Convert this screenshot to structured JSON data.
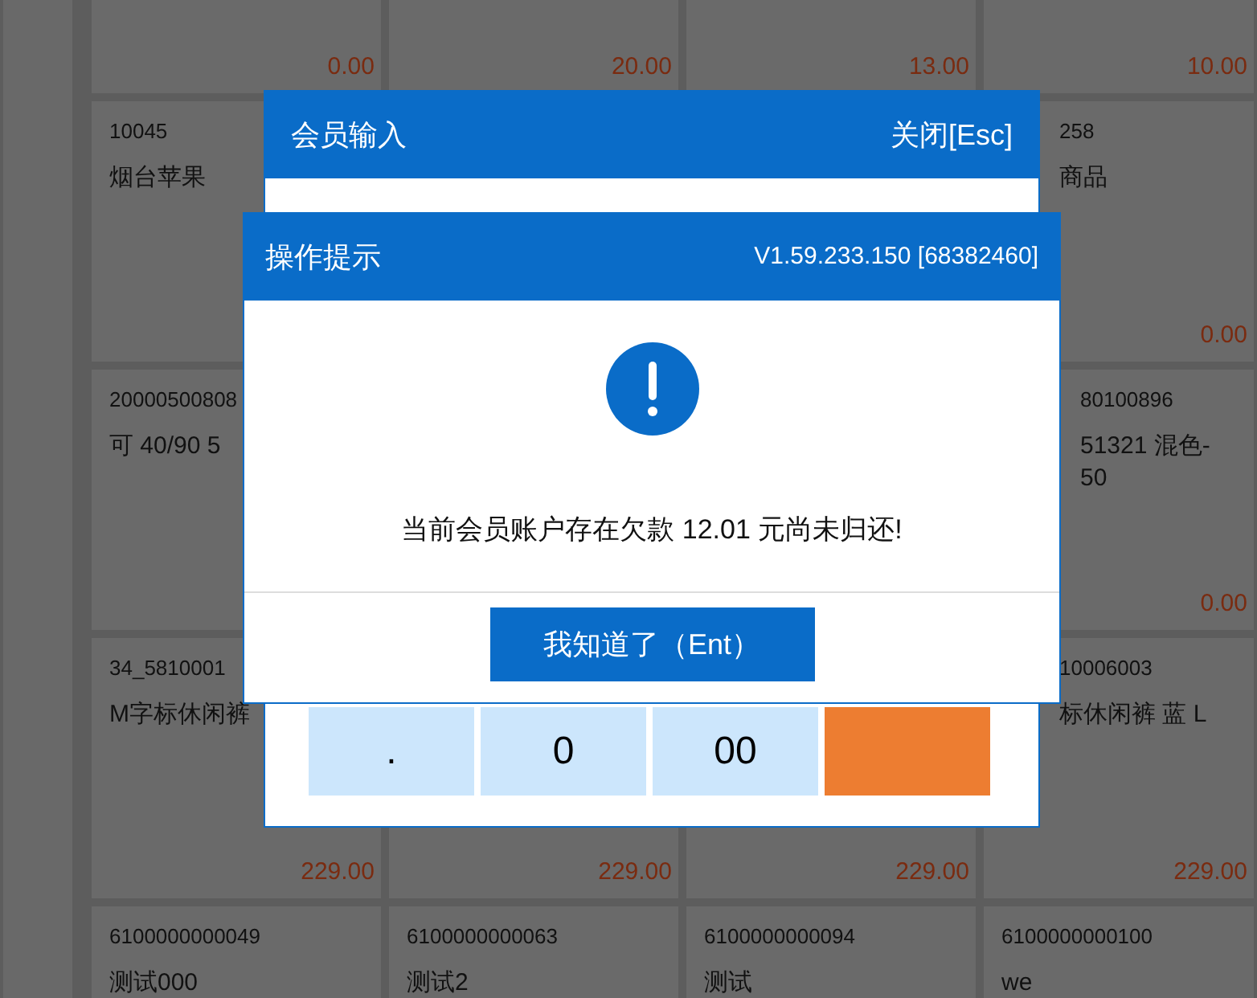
{
  "product_grid": [
    {
      "column_1": {
        "price": "0.00"
      },
      "column_2": {
        "price": "20.00"
      },
      "column_3": {
        "price": "13.00"
      },
      "column_4": {
        "price": "10.00"
      }
    },
    {
      "column_1": {
        "code": "10045",
        "name": [
          "烟台苹果"
        ]
      },
      "column_4": {
        "code": "258",
        "name": [
          "商品"
        ],
        "price": "0.00"
      }
    },
    {
      "column_1": {
        "code": "20000500808",
        "name": [
          "可 40/90 5"
        ]
      },
      "column_4": {
        "code": "80100896",
        "name": [
          "51321 混色-",
          "50"
        ],
        "price": "0.00"
      }
    },
    {
      "column_1": {
        "code": "34_5810001",
        "name": [
          "M字标休闲裤"
        ],
        "price": "229.00"
      },
      "column_2": {
        "price": "229.00"
      },
      "column_3": {
        "price": "229.00"
      },
      "column_4": {
        "code": "10006003",
        "name": [
          "标休闲裤 蓝 L"
        ],
        "price": "229.00"
      }
    },
    {
      "column_1": {
        "code": "6100000000049",
        "name": [
          "测试000"
        ]
      },
      "column_2": {
        "code": "6100000000063",
        "name": [
          "测试2"
        ]
      },
      "column_3": {
        "code": "6100000000094",
        "name": [
          "测试"
        ]
      },
      "column_4": {
        "code": "6100000000100",
        "name": [
          "we"
        ]
      }
    }
  ],
  "member_dialog": {
    "title": "会员输入",
    "close": "关闭[Esc]",
    "keypad": [
      {
        "label": ".",
        "kind": "digit"
      },
      {
        "label": "0",
        "kind": "digit"
      },
      {
        "label": "00",
        "kind": "digit"
      },
      {
        "kind": "action"
      }
    ]
  },
  "prompt_dialog": {
    "title": "操作提示",
    "version": "V1.59.233.150 [68382460]",
    "message": "当前会员账户存在欠款 12.01 元尚未归还!",
    "button": "我知道了（Ent）"
  }
}
